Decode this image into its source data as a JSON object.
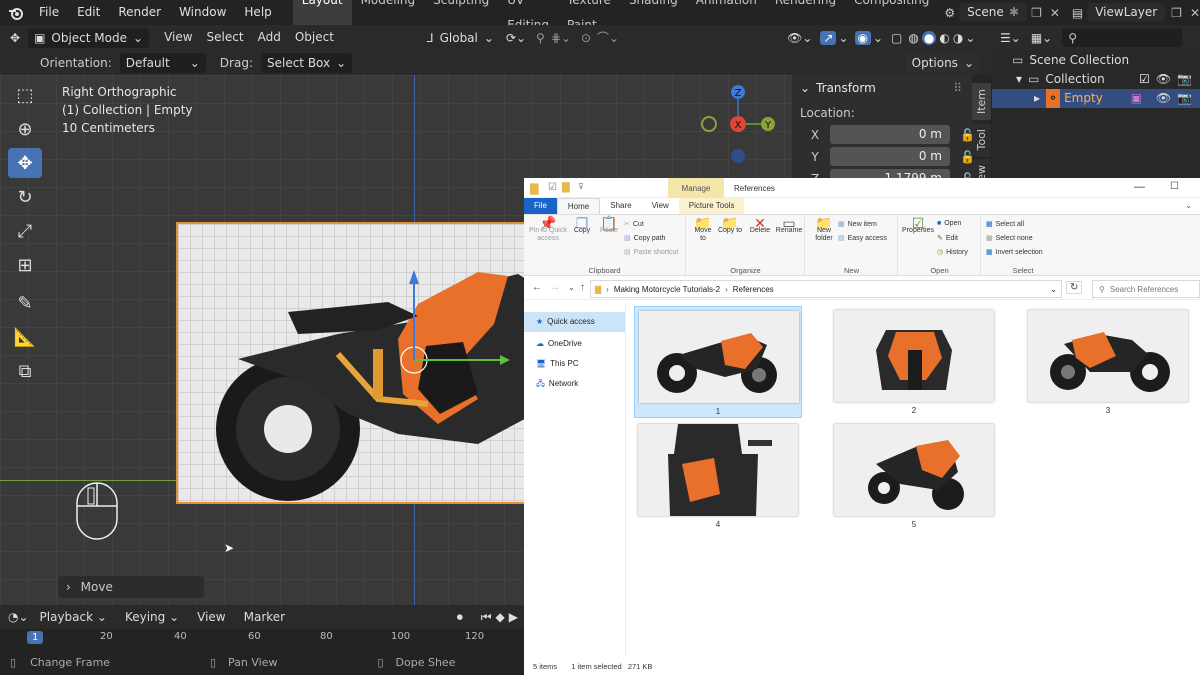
{
  "topbar": {
    "menus": [
      "File",
      "Edit",
      "Render",
      "Window",
      "Help"
    ],
    "workspaces": [
      "Layout",
      "Modeling",
      "Sculpting",
      "UV Editing",
      "Texture Paint",
      "Shading",
      "Animation",
      "Rendering",
      "Compositing"
    ],
    "active_workspace": "Layout",
    "scene": "Scene",
    "view_layer": "ViewLayer"
  },
  "header": {
    "mode": "Object Mode",
    "menus": [
      "View",
      "Select",
      "Add",
      "Object"
    ],
    "transform_orientation": "Global",
    "orientation_label": "Orientation:",
    "orientation_value": "Default",
    "drag_label": "Drag:",
    "drag_value": "Select Box",
    "options": "Options"
  },
  "viewport": {
    "view_name": "Right Orthographic",
    "collection_info": "(1) Collection | Empty",
    "scale_info": "10 Centimeters",
    "operator_panel": "Move",
    "gizmo": {
      "z": "Z",
      "x": "X",
      "y": "Y"
    }
  },
  "npanel": {
    "section": "Transform",
    "location_label": "Location:",
    "fields": [
      {
        "axis": "X",
        "value": "0 m"
      },
      {
        "axis": "Y",
        "value": "0 m"
      },
      {
        "axis": "Z",
        "value": "1.1799 m"
      }
    ],
    "tabs": [
      "Item",
      "Tool",
      "View"
    ]
  },
  "outliner": {
    "scene_collection": "Scene Collection",
    "collection": "Collection",
    "object": "Empty"
  },
  "timeline": {
    "menus": [
      "Playback",
      "Keying",
      "View",
      "Marker"
    ],
    "current_frame": "1",
    "ticks": [
      "20",
      "40",
      "60",
      "80",
      "100",
      "120"
    ]
  },
  "statusbar": {
    "items": [
      "Change Frame",
      "Pan View",
      "Dope Shee"
    ]
  },
  "explorer": {
    "context_tab": "Manage",
    "title": "References",
    "tabs": [
      "File",
      "Home",
      "Share",
      "View",
      "Picture Tools"
    ],
    "clipboard": {
      "pin": "Pin to Quick access",
      "copy": "Copy",
      "paste": "Paste",
      "cut": "Cut",
      "copy_path": "Copy path",
      "paste_shortcut": "Paste shortcut",
      "label": "Clipboard"
    },
    "organize": {
      "move_to": "Move to",
      "copy_to": "Copy to",
      "delete": "Delete",
      "rename": "Rename",
      "label": "Organize"
    },
    "new": {
      "new_folder": "New folder",
      "new_item": "New item",
      "easy_access": "Easy access",
      "label": "New"
    },
    "open": {
      "properties": "Properties",
      "open": "Open",
      "edit": "Edit",
      "history": "History",
      "label": "Open"
    },
    "select": {
      "select_all": "Select all",
      "select_none": "Select none",
      "invert": "Invert selection",
      "label": "Select"
    },
    "path": [
      "Making Motorcycle Tutorials-2",
      "References"
    ],
    "search_placeholder": "Search References",
    "nav": [
      "Quick access",
      "OneDrive",
      "This PC",
      "Network"
    ],
    "thumbnails": [
      "1",
      "2",
      "3",
      "4",
      "5"
    ],
    "status": {
      "count": "5 items",
      "selected": "1 item selected",
      "size": "271 KB"
    }
  },
  "colors": {
    "blender_accent": "#4772b3",
    "orange": "#e8702a",
    "explorer_blue": "#1a64c8"
  }
}
